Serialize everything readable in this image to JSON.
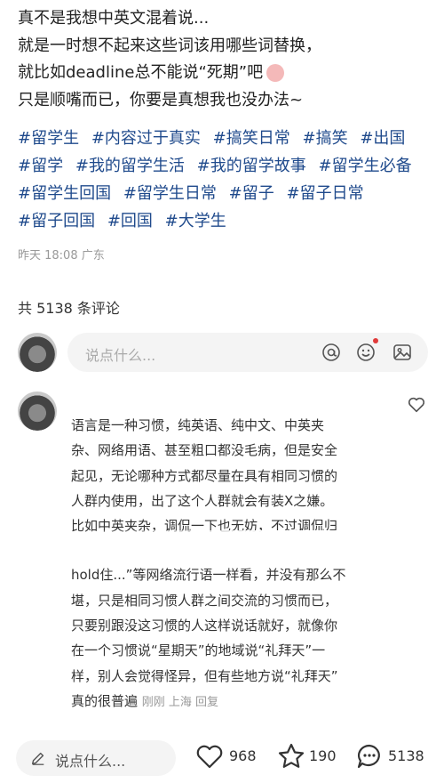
{
  "post": {
    "lines": [
      "真不是我想中英文混着说...",
      "就是一时想不起来这些词该用哪些词替换，",
      "就比如deadline总不能说“死期”吧",
      "只是顺嘴而已，你要是真想我也没办法~"
    ],
    "tags": [
      "#留学生",
      "#内容过于真实",
      "#搞笑日常",
      "#搞笑",
      "#出国",
      "#留学",
      "#我的留学生活",
      "#我的留学故事",
      "#留学生必备",
      "#留学生回国",
      "#留学生日常",
      "#留子",
      "#留子日常",
      "#留子回国",
      "#回国",
      "#大学生"
    ],
    "meta": "昨天 18:08 广东"
  },
  "comments_count_label": "共 5138 条评论",
  "comment_input": {
    "placeholder": "说点什么..."
  },
  "comment": {
    "lines": [
      "语言是一种习惯，纯英语、纯中文、中英夹",
      "杂、网络用语、甚至粗口都没毛病，但是安全",
      "起见，无论哪种方式都尽量在具有相同习惯的",
      "人群内使用，出了这个人群就会有装X之嫌。",
      "比如中英夹杂，调侃一下也无妨，不过调侃归",
      "hold住...”等网络流行语一样看，并没有那么不",
      "堪，只是相同习惯人群之间交流的习惯而已，",
      "只要别跟没这习惯的人这样说话就好，就像你",
      "在一个习惯说“星期天”的地域说“礼拜天”一",
      "样，别人会觉得怪异，但有些地方说“礼拜天”",
      "真的很普遍"
    ],
    "meta": "刚刚 上海 回复"
  },
  "bottom_bar": {
    "placeholder": "说点什么...",
    "likes": "968",
    "stars": "190",
    "comments": "5138"
  },
  "colors": {
    "tag": "#1f4a8c",
    "notification_dot": "#e03a3a"
  }
}
